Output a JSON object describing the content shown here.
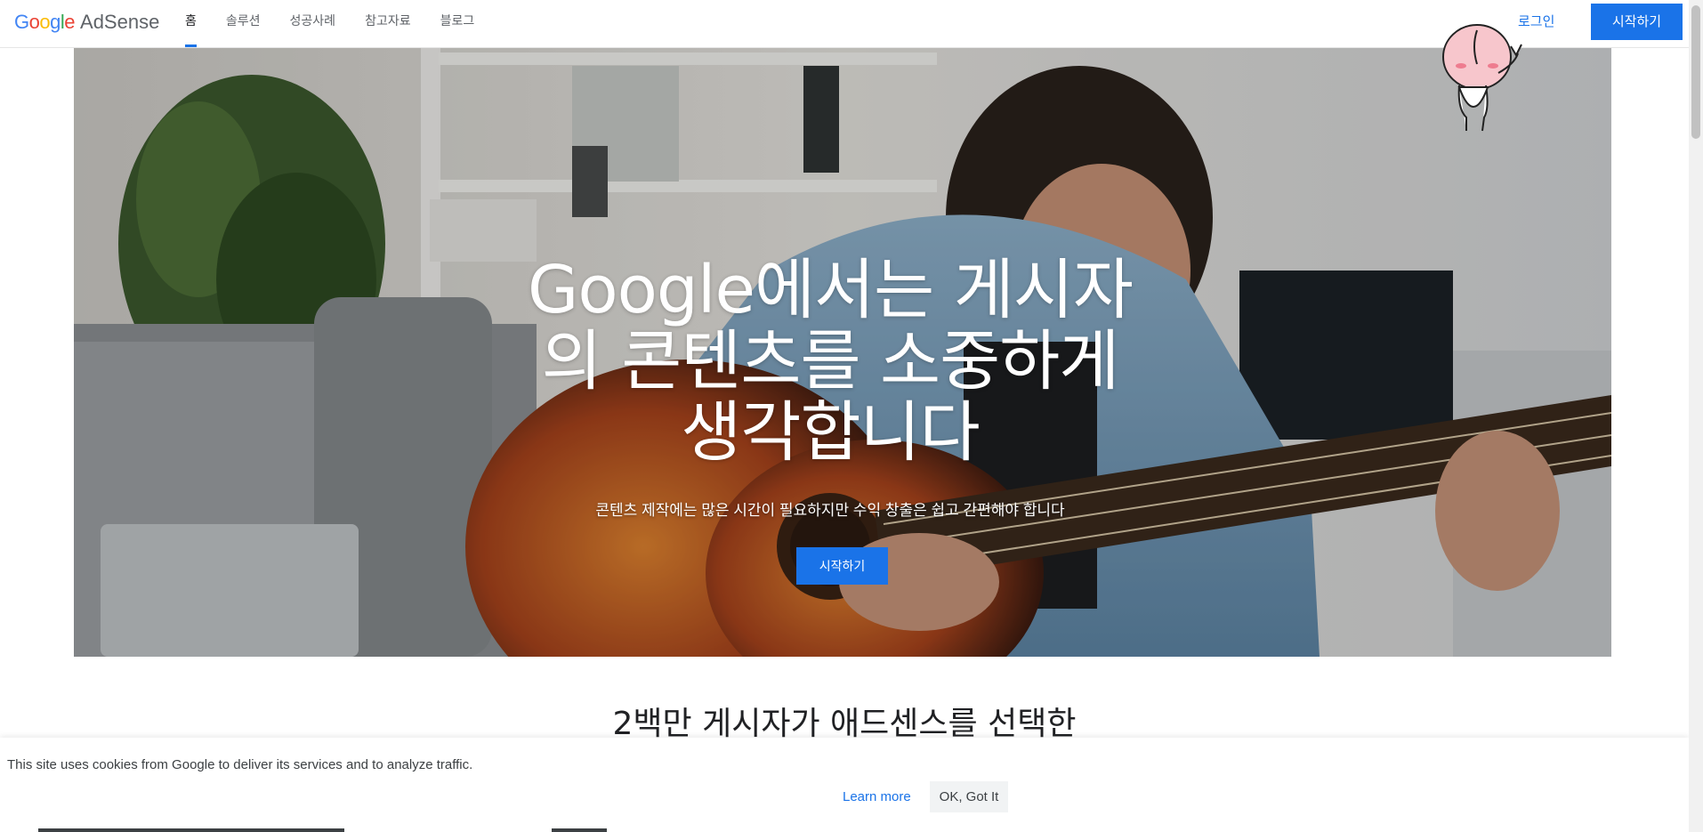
{
  "header": {
    "logo": {
      "google": "Google",
      "product": "AdSense"
    },
    "nav": [
      {
        "label": "홈",
        "active": true
      },
      {
        "label": "솔루션",
        "active": false
      },
      {
        "label": "성공사례",
        "active": false
      },
      {
        "label": "참고자료",
        "active": false
      },
      {
        "label": "블로그",
        "active": false
      }
    ],
    "login_label": "로그인",
    "start_label": "시작하기"
  },
  "hero": {
    "title_lines": [
      "Google에서는 게시자",
      "의 콘텐츠를 소중하게",
      "생각합니다"
    ],
    "subtitle": "콘텐츠 제작에는 많은 시간이 필요하지만 수익 창출은 쉽고 간편해야 합니다",
    "button_label": "시작하기"
  },
  "section": {
    "heading": "2백만 게시자가 애드센스를 선택한"
  },
  "cookie": {
    "text": "This site uses cookies from Google to deliver its services and to analyze traffic.",
    "learn_more": "Learn more",
    "ok": "OK, Got It"
  },
  "colors": {
    "accent": "#1a73e8",
    "text": "#202124",
    "muted": "#5f6368"
  },
  "icons": {
    "sticker": "peach-character-sticker"
  }
}
